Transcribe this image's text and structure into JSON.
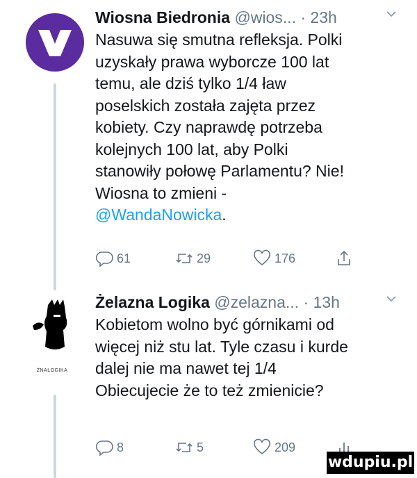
{
  "tweets": [
    {
      "author": "Wiosna Biedronia",
      "handle": "@wios...",
      "separator": "·",
      "time": "23h",
      "body": "Nasuwa się smutna refleksja. Polki\nuzyskały prawa wyborcze 100 lat\ntemu, ale dziś tylko 1/4 ław\nposelskich została zajęta przez\nkobiety. Czy naprawdę potrzeba\nkolejnych 100 lat, aby Polki\nstanowiły połowę Parlamentu? Nie!\nWiosna to zmieni -\n",
      "mention": "@WandaNowicka",
      "body_end": ".",
      "replies": "61",
      "retweets": "29",
      "likes": "176",
      "avatar_icon": "wiosna-logo-icon",
      "avatar_color": "#5b2ba0",
      "logo_color": "#ffffff"
    },
    {
      "author": "Żelazna Logika",
      "handle": "@zelazna...",
      "separator": "·",
      "time": "13h",
      "body": "Kobietom wolno być górnikami od\nwięcej niż stu lat. Tyle czasu i kurde\ndalej nie ma nawet tej 1/4\nObiecujecie że to też zmienicie?",
      "replies": "8",
      "retweets": "5",
      "likes": "209",
      "avatar_icon": "silhouette-logo-icon",
      "avatar_caption": "ŻNALOGIKA"
    }
  ],
  "watermark": "wdupiu.pl",
  "colors": {
    "mention": "#1da1f2",
    "muted": "#657786",
    "thread_line": "#ccd6dd"
  }
}
